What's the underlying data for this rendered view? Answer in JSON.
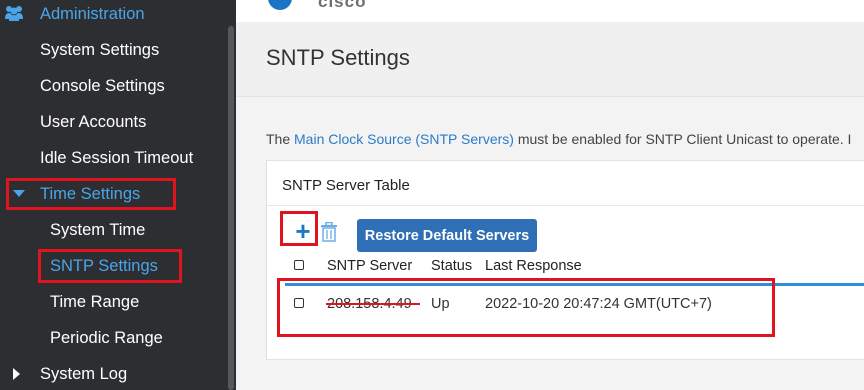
{
  "sidebar": {
    "section_label": "Administration",
    "items": [
      {
        "label": "System Settings"
      },
      {
        "label": "Console Settings"
      },
      {
        "label": "User Accounts"
      },
      {
        "label": "Idle Session Timeout"
      },
      {
        "label": "Time Settings"
      },
      {
        "label": "System Time"
      },
      {
        "label": "SNTP Settings"
      },
      {
        "label": "Time Range"
      },
      {
        "label": "Periodic Range"
      },
      {
        "label": "System Log"
      }
    ]
  },
  "header": {
    "brand": "cisco"
  },
  "page": {
    "title": "SNTP Settings",
    "info_prefix": "The ",
    "info_link": "Main Clock Source (SNTP Servers)",
    "info_suffix": " must be enabled for SNTP Client Unicast to operate. I"
  },
  "table": {
    "title": "SNTP Server Table",
    "add_icon": "+",
    "restore_label": "Restore Default Servers",
    "columns": [
      "SNTP Server",
      "Status",
      "Last Response"
    ],
    "rows": [
      {
        "server": "208.158.4.49",
        "status": "Up",
        "last_response": "2022-10-20 20:47:24 GMT(UTC+7)"
      }
    ]
  },
  "colors": {
    "accent": "#4aa5e8",
    "highlight": "#e0141e",
    "button": "#2f6fb5"
  }
}
